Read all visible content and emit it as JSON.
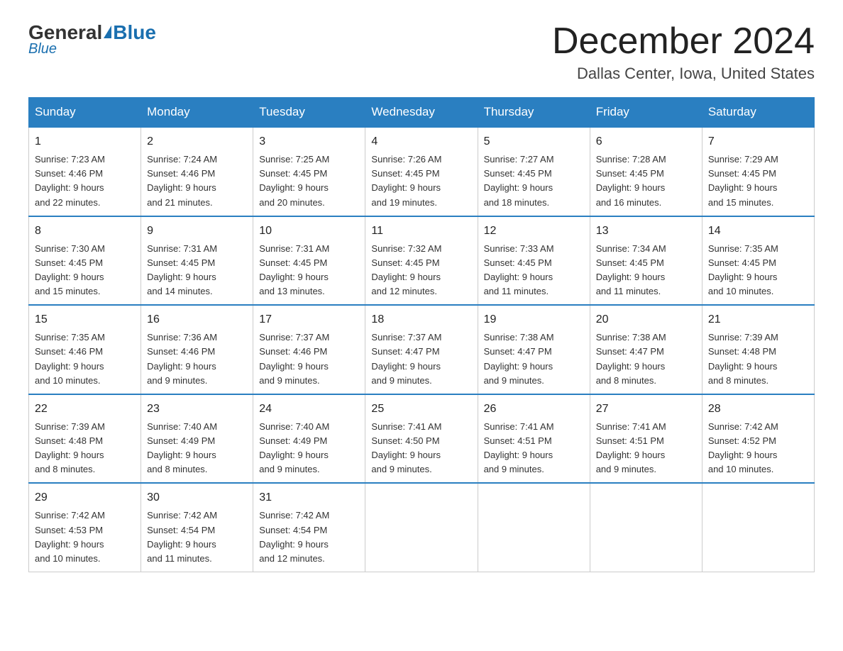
{
  "header": {
    "logo_general": "General",
    "logo_blue": "Blue",
    "title": "December 2024",
    "location": "Dallas Center, Iowa, United States"
  },
  "days_of_week": [
    "Sunday",
    "Monday",
    "Tuesday",
    "Wednesday",
    "Thursday",
    "Friday",
    "Saturday"
  ],
  "weeks": [
    [
      {
        "day": "1",
        "sunrise": "7:23 AM",
        "sunset": "4:46 PM",
        "daylight": "9 hours and 22 minutes."
      },
      {
        "day": "2",
        "sunrise": "7:24 AM",
        "sunset": "4:46 PM",
        "daylight": "9 hours and 21 minutes."
      },
      {
        "day": "3",
        "sunrise": "7:25 AM",
        "sunset": "4:45 PM",
        "daylight": "9 hours and 20 minutes."
      },
      {
        "day": "4",
        "sunrise": "7:26 AM",
        "sunset": "4:45 PM",
        "daylight": "9 hours and 19 minutes."
      },
      {
        "day": "5",
        "sunrise": "7:27 AM",
        "sunset": "4:45 PM",
        "daylight": "9 hours and 18 minutes."
      },
      {
        "day": "6",
        "sunrise": "7:28 AM",
        "sunset": "4:45 PM",
        "daylight": "9 hours and 16 minutes."
      },
      {
        "day": "7",
        "sunrise": "7:29 AM",
        "sunset": "4:45 PM",
        "daylight": "9 hours and 15 minutes."
      }
    ],
    [
      {
        "day": "8",
        "sunrise": "7:30 AM",
        "sunset": "4:45 PM",
        "daylight": "9 hours and 15 minutes."
      },
      {
        "day": "9",
        "sunrise": "7:31 AM",
        "sunset": "4:45 PM",
        "daylight": "9 hours and 14 minutes."
      },
      {
        "day": "10",
        "sunrise": "7:31 AM",
        "sunset": "4:45 PM",
        "daylight": "9 hours and 13 minutes."
      },
      {
        "day": "11",
        "sunrise": "7:32 AM",
        "sunset": "4:45 PM",
        "daylight": "9 hours and 12 minutes."
      },
      {
        "day": "12",
        "sunrise": "7:33 AM",
        "sunset": "4:45 PM",
        "daylight": "9 hours and 11 minutes."
      },
      {
        "day": "13",
        "sunrise": "7:34 AM",
        "sunset": "4:45 PM",
        "daylight": "9 hours and 11 minutes."
      },
      {
        "day": "14",
        "sunrise": "7:35 AM",
        "sunset": "4:45 PM",
        "daylight": "9 hours and 10 minutes."
      }
    ],
    [
      {
        "day": "15",
        "sunrise": "7:35 AM",
        "sunset": "4:46 PM",
        "daylight": "9 hours and 10 minutes."
      },
      {
        "day": "16",
        "sunrise": "7:36 AM",
        "sunset": "4:46 PM",
        "daylight": "9 hours and 9 minutes."
      },
      {
        "day": "17",
        "sunrise": "7:37 AM",
        "sunset": "4:46 PM",
        "daylight": "9 hours and 9 minutes."
      },
      {
        "day": "18",
        "sunrise": "7:37 AM",
        "sunset": "4:47 PM",
        "daylight": "9 hours and 9 minutes."
      },
      {
        "day": "19",
        "sunrise": "7:38 AM",
        "sunset": "4:47 PM",
        "daylight": "9 hours and 9 minutes."
      },
      {
        "day": "20",
        "sunrise": "7:38 AM",
        "sunset": "4:47 PM",
        "daylight": "9 hours and 8 minutes."
      },
      {
        "day": "21",
        "sunrise": "7:39 AM",
        "sunset": "4:48 PM",
        "daylight": "9 hours and 8 minutes."
      }
    ],
    [
      {
        "day": "22",
        "sunrise": "7:39 AM",
        "sunset": "4:48 PM",
        "daylight": "9 hours and 8 minutes."
      },
      {
        "day": "23",
        "sunrise": "7:40 AM",
        "sunset": "4:49 PM",
        "daylight": "9 hours and 8 minutes."
      },
      {
        "day": "24",
        "sunrise": "7:40 AM",
        "sunset": "4:49 PM",
        "daylight": "9 hours and 9 minutes."
      },
      {
        "day": "25",
        "sunrise": "7:41 AM",
        "sunset": "4:50 PM",
        "daylight": "9 hours and 9 minutes."
      },
      {
        "day": "26",
        "sunrise": "7:41 AM",
        "sunset": "4:51 PM",
        "daylight": "9 hours and 9 minutes."
      },
      {
        "day": "27",
        "sunrise": "7:41 AM",
        "sunset": "4:51 PM",
        "daylight": "9 hours and 9 minutes."
      },
      {
        "day": "28",
        "sunrise": "7:42 AM",
        "sunset": "4:52 PM",
        "daylight": "9 hours and 10 minutes."
      }
    ],
    [
      {
        "day": "29",
        "sunrise": "7:42 AM",
        "sunset": "4:53 PM",
        "daylight": "9 hours and 10 minutes."
      },
      {
        "day": "30",
        "sunrise": "7:42 AM",
        "sunset": "4:54 PM",
        "daylight": "9 hours and 11 minutes."
      },
      {
        "day": "31",
        "sunrise": "7:42 AM",
        "sunset": "4:54 PM",
        "daylight": "9 hours and 12 minutes."
      },
      null,
      null,
      null,
      null
    ]
  ],
  "labels": {
    "sunrise": "Sunrise:",
    "sunset": "Sunset:",
    "daylight": "Daylight:"
  }
}
